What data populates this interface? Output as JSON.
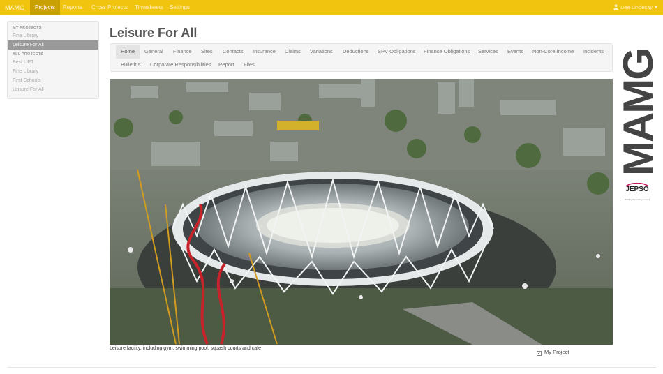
{
  "navbar": {
    "brand": "MAMG",
    "items": [
      {
        "label": "Projects",
        "active": true
      },
      {
        "label": "Reports",
        "active": false
      },
      {
        "label": "Cross Projects",
        "active": false
      },
      {
        "label": "Timesheets",
        "active": false
      },
      {
        "label": "Settings",
        "active": false
      }
    ],
    "user": "Dee Lindesay",
    "user_icon": "person-icon",
    "color": "#f1c40f"
  },
  "sidebar": {
    "my_projects_header": "MY PROJECTS",
    "my_projects": [
      "Fine Library",
      "Leisure For All"
    ],
    "my_projects_active": "Leisure For All",
    "all_projects_header": "ALL PROJECTS",
    "all_projects": [
      "Best LIFT",
      "Fine Library",
      "First Schools",
      "Leisure For All"
    ]
  },
  "main": {
    "title": "Leisure For All",
    "tabs": [
      "Home",
      "General",
      "Finance",
      "Sites",
      "Contacts",
      "Insurance",
      "Claims",
      "Variations",
      "Deductions",
      "SPV Obligations",
      "Finance Obligations",
      "Services",
      "Events",
      "Non-Core Income",
      "Incidents",
      "Bulletins",
      "Corporate Responsibilities",
      "Report",
      "Files"
    ],
    "active_tab": "Home",
    "caption": "Leisure facility, including gym, swimming pool, squash courts and cafe",
    "my_project_label": "My Project",
    "my_project_checked": true
  },
  "logo": {
    "text": "MAMG",
    "partner": "JEPSO",
    "tagline": "Building the tools you need"
  }
}
